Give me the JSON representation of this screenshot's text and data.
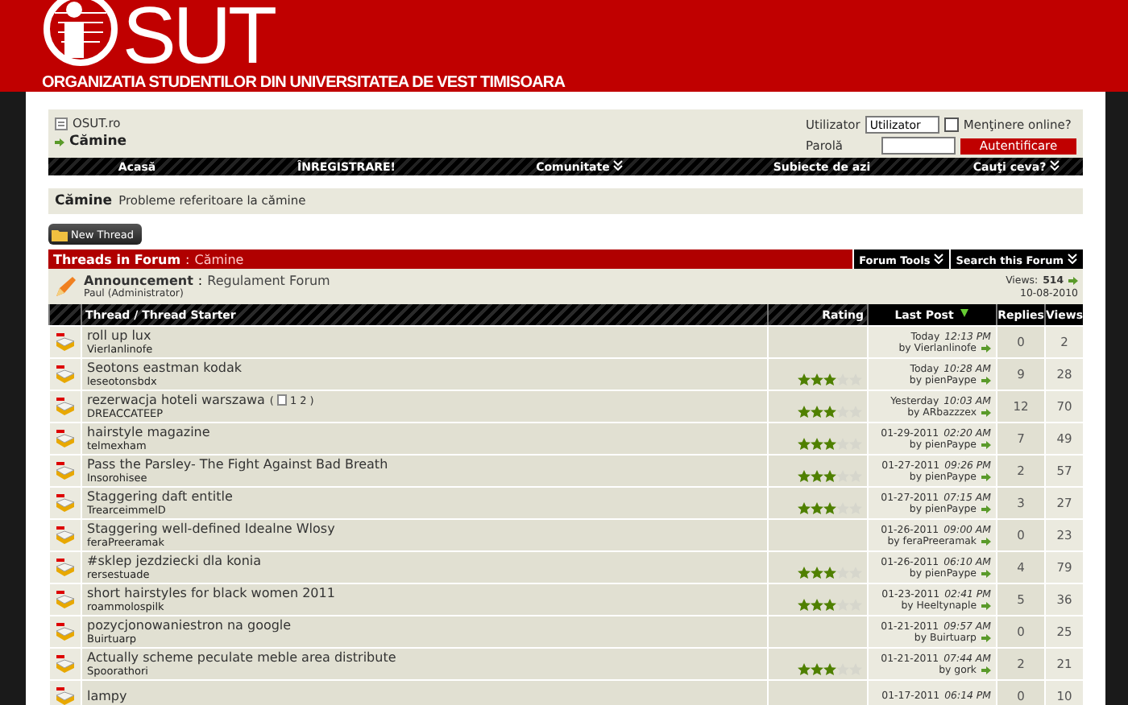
{
  "header": {
    "logo_text": "SUT",
    "subtitle": "ORGANIZATIA STUDENTILOR DIN UNIVERSITATEA DE VEST TIMISOARA"
  },
  "breadcrumb": {
    "site": "OSUT.ro",
    "current": "Cămine"
  },
  "login": {
    "user_label": "Utilizator",
    "user_value": "Utilizator",
    "remember_label": "Menţinere online?",
    "remember_checked": false,
    "password_label": "Parolă",
    "submit": "Autentificare"
  },
  "nav": [
    {
      "label": "Acasă",
      "dropdown": false
    },
    {
      "label": "ÎNREGISTRARE!",
      "dropdown": false
    },
    {
      "label": "Comunitate",
      "dropdown": true
    },
    {
      "label": "Subiecte de azi",
      "dropdown": false
    },
    {
      "label": "Cauţi ceva?",
      "dropdown": true
    }
  ],
  "forum_info": {
    "title": "Cămine",
    "description": "Probleme referitoare la cămine"
  },
  "new_thread_button": "New Thread",
  "forum_bar": {
    "label": "Threads in Forum",
    "separator": ":",
    "forum": "Cămine",
    "tools": [
      {
        "label": "Forum Tools"
      },
      {
        "label": "Search this Forum"
      }
    ]
  },
  "announcement": {
    "label": "Announcement",
    "separator": ":",
    "title": "Regulament Forum",
    "author": "Paul (Administrator)",
    "views_label": "Views:",
    "views": "514",
    "date": "10-08-2010"
  },
  "table": {
    "columns": [
      "Thread / Thread Starter",
      "Rating",
      "Last Post",
      "Replies",
      "Views"
    ],
    "rows": [
      {
        "title": "roll up lux",
        "starter": "Vierlanlinofe",
        "date": "Today",
        "time": "12:13 PM",
        "by": "by Vierlanlinofe",
        "replies": "0",
        "views": "2"
      },
      {
        "title": "Seotons eastman kodak",
        "starter": "leseotonsbdx",
        "stars": 3,
        "date": "Today",
        "time": "10:28 AM",
        "by": "by pienPaype",
        "replies": "9",
        "views": "28"
      },
      {
        "title": "rezerwacja hoteli warszawa",
        "pager": {
          "open": "(",
          "pages": [
            "1",
            "2"
          ],
          "close": ")"
        },
        "starter": "DREACCATEEP",
        "stars": 3,
        "date": "Yesterday",
        "time": "10:03 AM",
        "by": "by ARbazzzex",
        "replies": "12",
        "views": "70"
      },
      {
        "title": "hairstyle magazine",
        "starter": "telmexham",
        "stars": 3,
        "date": "01-29-2011",
        "time": "02:20 AM",
        "by": "by pienPaype",
        "replies": "7",
        "views": "49"
      },
      {
        "title": "Pass the Parsley- The Fight Against Bad Breath",
        "starter": "Insorohisee",
        "stars": 3,
        "date": "01-27-2011",
        "time": "09:26 PM",
        "by": "by pienPaype",
        "replies": "2",
        "views": "57"
      },
      {
        "title": "Staggering daft entitle",
        "starter": "TrearceimmelD",
        "stars": 3,
        "date": "01-27-2011",
        "time": "07:15 AM",
        "by": "by pienPaype",
        "replies": "3",
        "views": "27"
      },
      {
        "title": "Staggering well-defined Idealne Wlosy",
        "starter": "feraPreeramak",
        "date": "01-26-2011",
        "time": "09:00 AM",
        "by": "by feraPreeramak",
        "replies": "0",
        "views": "23"
      },
      {
        "title": "#sklep jezdziecki dla konia",
        "starter": "rersestuade",
        "stars": 3,
        "date": "01-26-2011",
        "time": "06:10 AM",
        "by": "by pienPaype",
        "replies": "4",
        "views": "79"
      },
      {
        "title": "short hairstyles for black women 2011",
        "starter": "roammolospilk",
        "stars": 3,
        "date": "01-23-2011",
        "time": "02:41 PM",
        "by": "by Heeltynaple",
        "replies": "5",
        "views": "36"
      },
      {
        "title": "pozycjonowaniestron na google",
        "starter": "Buirtuarp",
        "date": "01-21-2011",
        "time": "09:57 AM",
        "by": "by Buirtuarp",
        "replies": "0",
        "views": "25"
      },
      {
        "title": "Actually scheme peculate meble area distribute",
        "starter": "Spoorathori",
        "stars": 3,
        "date": "01-21-2011",
        "time": "07:44 AM",
        "by": "by gork",
        "replies": "2",
        "views": "21"
      },
      {
        "title": "lampy",
        "date": "01-17-2011",
        "time": "06:14 PM",
        "replies": "0",
        "views": "10"
      }
    ]
  }
}
